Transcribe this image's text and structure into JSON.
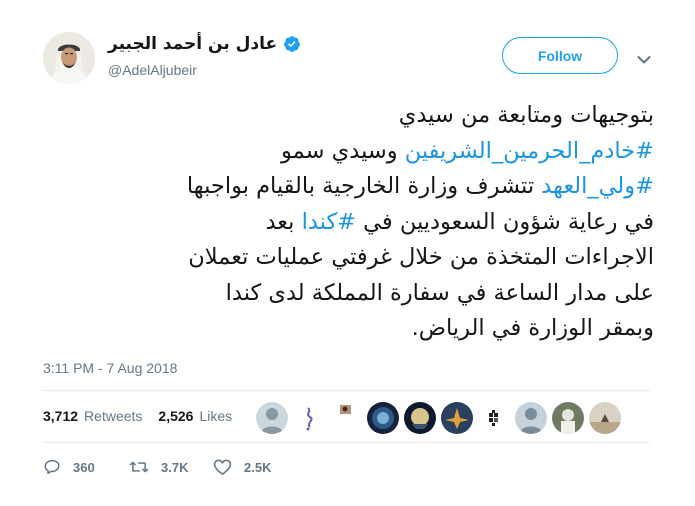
{
  "user": {
    "display_name": "عادل بن أحمد الجبير",
    "handle": "@AdelAljubeir",
    "verified_icon": "verified-badge-icon",
    "avatar_icon": "avatar"
  },
  "header": {
    "follow_label": "Follow",
    "menu_icon": "chevron-down-icon"
  },
  "tweet": {
    "lines": [
      [
        {
          "t": "بتوجيهات ومتابعة من سيدي",
          "tag": false
        }
      ],
      [
        {
          "t": "#خادم_الحرمين_الشريفين",
          "tag": true
        },
        {
          "t": " وسيدي سمو",
          "tag": false
        }
      ],
      [
        {
          "t": "#ولي_العهد",
          "tag": true
        },
        {
          "t": " تتشرف وزارة الخارجية بالقيام بواجبها",
          "tag": false
        }
      ],
      [
        {
          "t": "في رعاية شؤون السعوديين في ",
          "tag": false
        },
        {
          "t": "#كندا",
          "tag": true
        },
        {
          "t": " بعد",
          "tag": false
        }
      ],
      [
        {
          "t": "الاجراءات المتخذة من خلال غرفتي عمليات تعملان",
          "tag": false
        }
      ],
      [
        {
          "t": "على مدار الساعة في سفارة المملكة لدى كندا",
          "tag": false
        }
      ],
      [
        {
          "t": "وبمقر الوزارة في الرياض.",
          "tag": false
        }
      ]
    ]
  },
  "timestamp": "3:11 PM - 7 Aug 2018",
  "stats": {
    "retweets_count": "3,712",
    "retweets_label": "Retweets",
    "likes_count": "2,526",
    "likes_label": "Likes"
  },
  "actions": {
    "reply_count": "360",
    "retweet_count": "3.7K",
    "like_count": "2.5K"
  },
  "colors": {
    "accent": "#1da1f2",
    "hashtag": "#1b95e0",
    "muted": "#657786",
    "text": "#14171a"
  }
}
